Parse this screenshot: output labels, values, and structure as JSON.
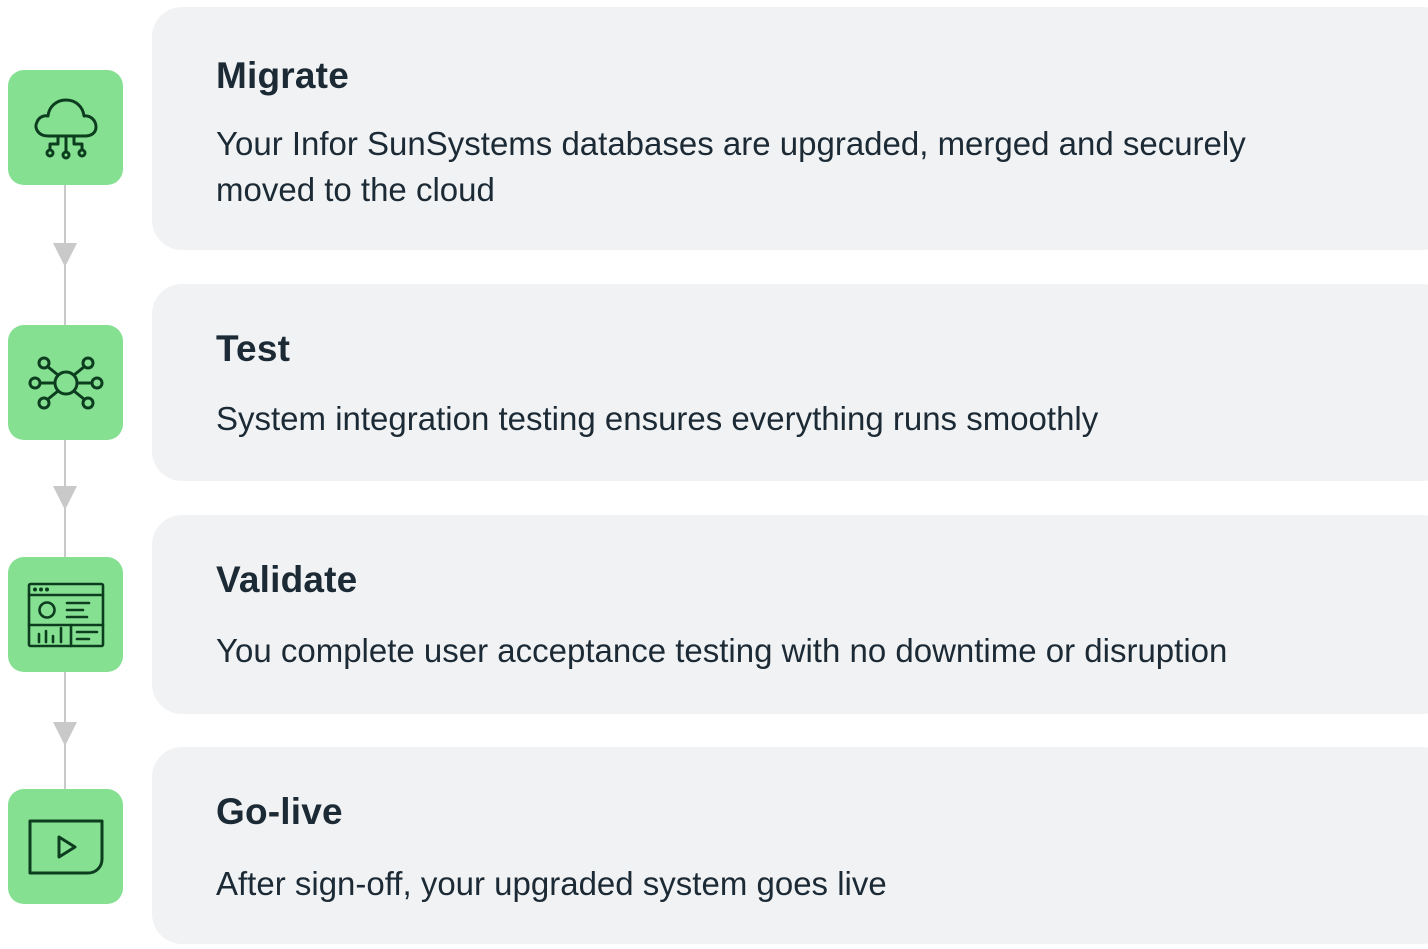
{
  "steps": [
    {
      "title": "Migrate",
      "description": "Your Infor SunSystems databases are upgraded, merged and securely moved to the cloud",
      "icon": "cloud-network-icon"
    },
    {
      "title": "Test",
      "description": "System integration testing ensures everything runs smoothly",
      "icon": "hub-network-icon"
    },
    {
      "title": "Validate",
      "description": "You complete user acceptance testing with no downtime or disruption",
      "icon": "dashboard-window-icon"
    },
    {
      "title": "Go-live",
      "description": "After sign-off, your upgraded system goes live",
      "icon": "play-screen-icon"
    }
  ],
  "colors": {
    "icon_background": "#86e092",
    "icon_stroke": "#0d3d1f",
    "card_background": "#f1f2f4",
    "connector": "#c9c9c9",
    "text": "#1b2a35"
  }
}
